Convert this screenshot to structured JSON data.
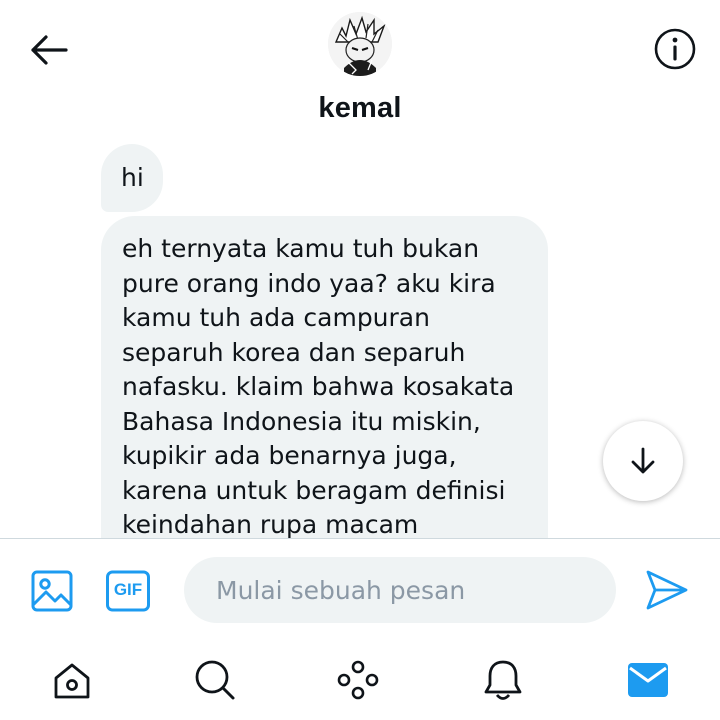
{
  "header": {
    "contact_name": "kemal",
    "back_icon": "arrow-left-icon",
    "info_icon": "info-icon"
  },
  "messages": [
    {
      "text": "hi"
    },
    {
      "text": "eh ternyata kamu tuh bukan\npure orang indo yaa? aku kira\nkamu tuh ada campuran\nseparuh korea dan separuh\nnafasku. klaim bahwa kosakata\nBahasa Indonesia itu miskin,\nkupikir ada benarnya juga,\nkarena untuk beragam definisi\nkeindahan rupa macam"
    }
  ],
  "composer": {
    "placeholder": "Mulai sebuah pesan",
    "gif_label": "GIF",
    "media_icon": "image-icon",
    "send_icon": "send-icon"
  },
  "nav": {
    "items": [
      {
        "icon": "home-icon",
        "active": false
      },
      {
        "icon": "search-icon",
        "active": false
      },
      {
        "icon": "spaces-icon",
        "active": false
      },
      {
        "icon": "bell-icon",
        "active": false
      },
      {
        "icon": "mail-icon",
        "active": true
      }
    ]
  },
  "colors": {
    "accent": "#1d9bf0",
    "bubble_bg": "#eff3f4",
    "text": "#0f1419",
    "placeholder": "#8b98a5"
  }
}
